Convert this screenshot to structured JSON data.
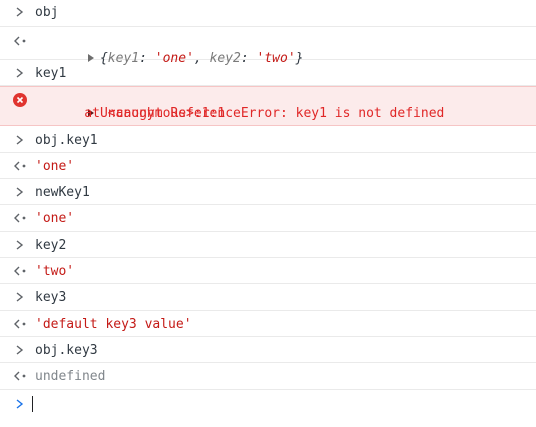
{
  "console": {
    "entries": [
      {
        "kind": "input",
        "text": "obj"
      },
      {
        "kind": "result-object",
        "open_brace": "{",
        "key1": "key1",
        "colon1": ":",
        "val1": "'one'",
        "comma": ",",
        "key2": "key2",
        "colon2": ":",
        "val2": "'two'",
        "close_brace": "}"
      },
      {
        "kind": "input",
        "text": "key1"
      },
      {
        "kind": "error",
        "message": "Uncaught ReferenceError: key1 is not defined",
        "trace": "    at <anonymous>:1:1"
      },
      {
        "kind": "input",
        "text": "obj.key1"
      },
      {
        "kind": "result-string",
        "text": "'one'"
      },
      {
        "kind": "input",
        "text": "newKey1"
      },
      {
        "kind": "result-string",
        "text": "'one'"
      },
      {
        "kind": "input",
        "text": "key2"
      },
      {
        "kind": "result-string",
        "text": "'two'"
      },
      {
        "kind": "input",
        "text": "key3"
      },
      {
        "kind": "result-string",
        "text": "'default key3 value'"
      },
      {
        "kind": "input",
        "text": "obj.key3"
      },
      {
        "kind": "result-undefined",
        "text": "undefined"
      }
    ],
    "prompt_input_value": ""
  },
  "icons": {
    "input_prompt": "chevron-right-icon",
    "result_marker": "return-arrow-icon",
    "error_marker": "error-circle-icon",
    "expand": "expand-triangle-icon",
    "active_prompt": "chevron-right-icon"
  },
  "colors": {
    "string": "#c41a16",
    "error_text": "#e02727",
    "error_background": "#fcebeb",
    "error_icon": "#e0342f",
    "undefined": "#80868b",
    "active_prompt": "#1a73e8"
  }
}
